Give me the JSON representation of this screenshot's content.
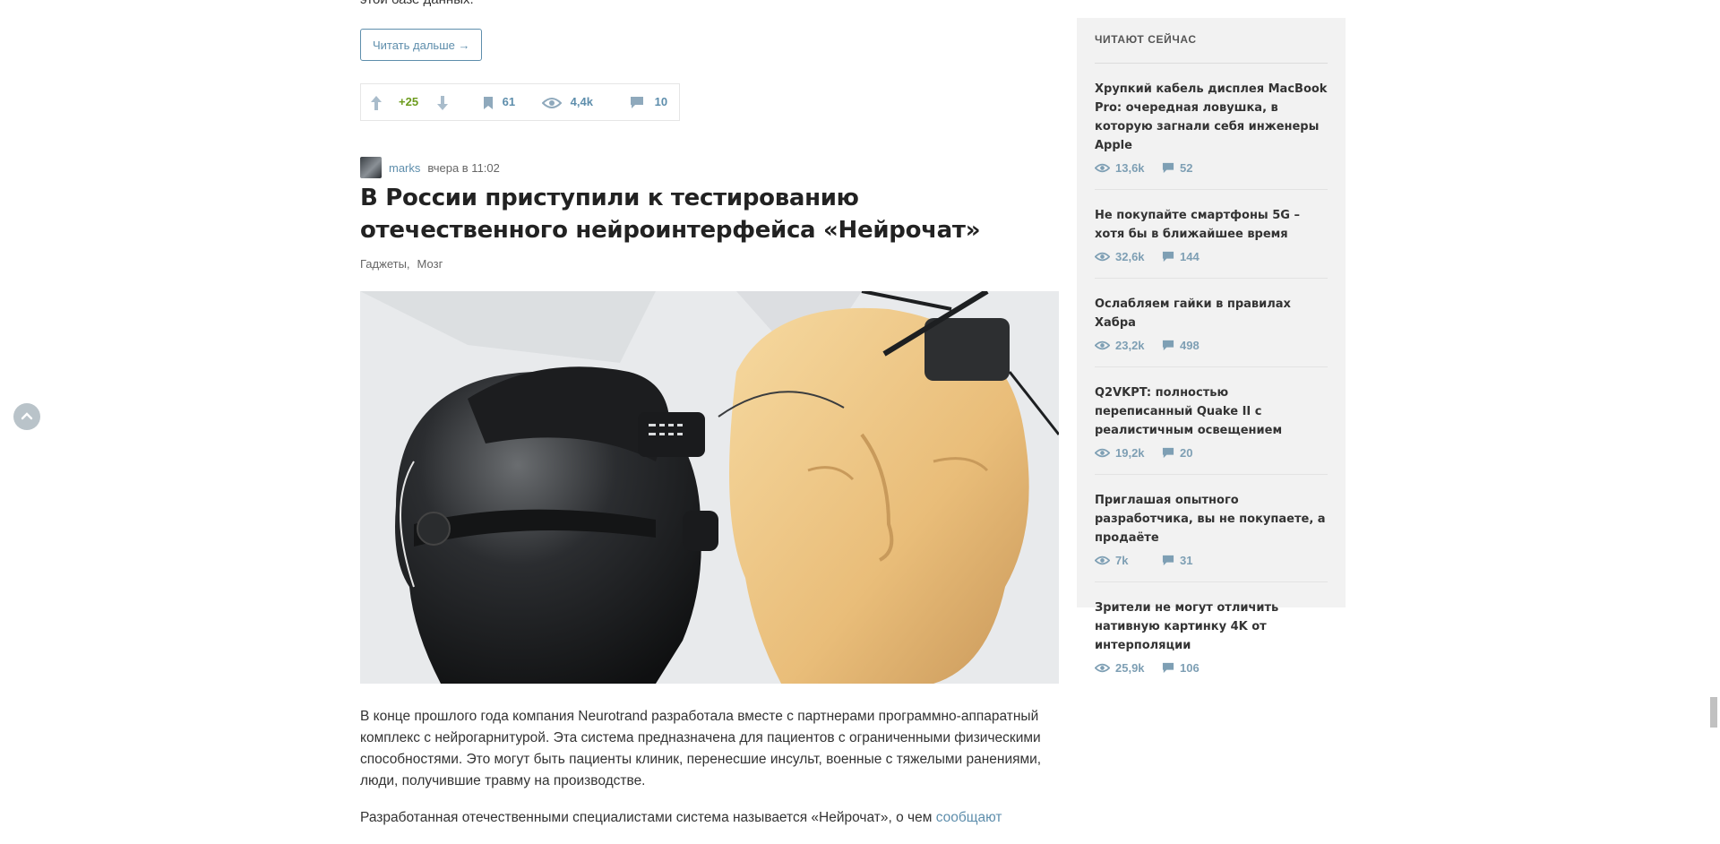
{
  "previous_post": {
    "text_tail": "этой базе данных.",
    "read_more_label": "Читать дальше →",
    "score": "+25",
    "bookmarks": "61",
    "views": "4,4k",
    "comments": "10"
  },
  "post": {
    "author": "marks",
    "time": "вчера в 11:02",
    "title": "В России приступили к тестированию отечественного нейроинтерфейса «Нейрочат»",
    "hubs": [
      "Гаджеты",
      "Мозг"
    ],
    "paragraph_1": "В конце прошлого года компания Neurotrand разработала вместе с партнерами программно-аппаратный комплекс с нейрогарнитурой. Эта система предназначена для пациентов с ограниченными физическими способностями. Это могут быть пациенты клиник, перенесшие инсульт, военные с тяжелыми ранениями, люди, получившие травму на производстве.",
    "paragraph_2_text": "Разработанная отечественными специалистами система называется «Нейрочат», о чем ",
    "paragraph_2_link": "сообщают"
  },
  "sidebar": {
    "heading": "ЧИТАЮТ СЕЙЧАС",
    "items": [
      {
        "title": "Хрупкий кабель дисплея MacBook Pro: очередная ловушка, в которую загнали себя инженеры Apple",
        "views": "13,6k",
        "comments": "52"
      },
      {
        "title": "Не покупайте смартфоны 5G – хотя бы в ближайшее время",
        "views": "32,6k",
        "comments": "144"
      },
      {
        "title": "Ослабляем гайки в правилах Хабра",
        "views": "23,2k",
        "comments": "498"
      },
      {
        "title": "Q2VKPT: полностью переписанный Quake II с реалистичным освещением",
        "views": "19,2k",
        "comments": "20"
      },
      {
        "title": "Приглашая опытного разработчика, вы не покупаете, а продаёте",
        "views": "7k",
        "comments": "31"
      },
      {
        "title": "Зрители не могут отличить нативную картинку 4K от интерполяции",
        "views": "25,9k",
        "comments": "106"
      }
    ]
  },
  "colors": {
    "accent": "#5e8eac",
    "score_positive": "#6c9b1d",
    "sidebar_bg": "#f2f2f2"
  },
  "icons": [
    "arrow-up-icon",
    "arrow-down-icon",
    "bookmark-icon",
    "eye-icon",
    "comment-icon",
    "chevron-up-icon"
  ]
}
